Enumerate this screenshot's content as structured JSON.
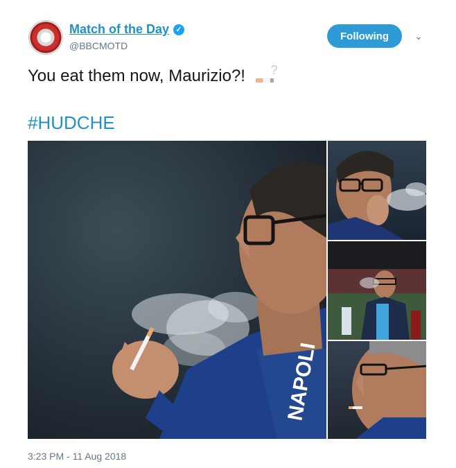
{
  "tweet": {
    "account_name": "Match of the Day",
    "handle": "@BBCMOTD",
    "follow_label": "Following",
    "text": "You eat them now, Maurizio?!",
    "hashtag": "#HUDCHE",
    "timestamp": "3:23 PM - 11 Aug 2018",
    "icons": {
      "verified": "verified-badge-icon",
      "menu": "chevron-down-icon",
      "emoji": "cigarette-question-emoji"
    },
    "colors": {
      "link": "#2191c5",
      "button": "#2e9bd6",
      "muted": "#657786"
    },
    "jersey_text": "NAPOLI"
  }
}
